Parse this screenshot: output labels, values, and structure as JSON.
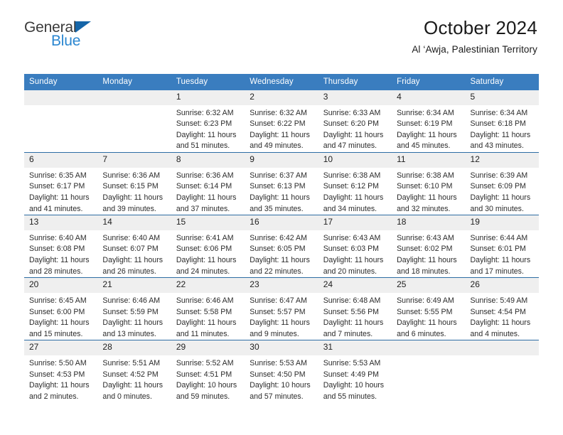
{
  "brand": {
    "line1": "General",
    "line2": "Blue",
    "flag_color": "#1565a8",
    "blue_text_color": "#2a86d0"
  },
  "header": {
    "title": "October 2024",
    "subtitle": "Al ‘Awja, Palestinian Territory"
  },
  "theme": {
    "header_bg": "#3a7dbf",
    "row_divider": "#2e6da4",
    "daynum_bg": "#efefef"
  },
  "calendar": {
    "weekday_headers": [
      "Sunday",
      "Monday",
      "Tuesday",
      "Wednesday",
      "Thursday",
      "Friday",
      "Saturday"
    ],
    "labels": {
      "sunrise": "Sunrise:",
      "sunset": "Sunset:",
      "daylight": "Daylight:"
    },
    "weeks": [
      [
        {
          "day": "",
          "empty": true
        },
        {
          "day": "",
          "empty": true
        },
        {
          "day": "1",
          "sunrise": "Sunrise: 6:32 AM",
          "sunset": "Sunset: 6:23 PM",
          "daylight": "Daylight: 11 hours and 51 minutes."
        },
        {
          "day": "2",
          "sunrise": "Sunrise: 6:32 AM",
          "sunset": "Sunset: 6:22 PM",
          "daylight": "Daylight: 11 hours and 49 minutes."
        },
        {
          "day": "3",
          "sunrise": "Sunrise: 6:33 AM",
          "sunset": "Sunset: 6:20 PM",
          "daylight": "Daylight: 11 hours and 47 minutes."
        },
        {
          "day": "4",
          "sunrise": "Sunrise: 6:34 AM",
          "sunset": "Sunset: 6:19 PM",
          "daylight": "Daylight: 11 hours and 45 minutes."
        },
        {
          "day": "5",
          "sunrise": "Sunrise: 6:34 AM",
          "sunset": "Sunset: 6:18 PM",
          "daylight": "Daylight: 11 hours and 43 minutes."
        }
      ],
      [
        {
          "day": "6",
          "sunrise": "Sunrise: 6:35 AM",
          "sunset": "Sunset: 6:17 PM",
          "daylight": "Daylight: 11 hours and 41 minutes."
        },
        {
          "day": "7",
          "sunrise": "Sunrise: 6:36 AM",
          "sunset": "Sunset: 6:15 PM",
          "daylight": "Daylight: 11 hours and 39 minutes."
        },
        {
          "day": "8",
          "sunrise": "Sunrise: 6:36 AM",
          "sunset": "Sunset: 6:14 PM",
          "daylight": "Daylight: 11 hours and 37 minutes."
        },
        {
          "day": "9",
          "sunrise": "Sunrise: 6:37 AM",
          "sunset": "Sunset: 6:13 PM",
          "daylight": "Daylight: 11 hours and 35 minutes."
        },
        {
          "day": "10",
          "sunrise": "Sunrise: 6:38 AM",
          "sunset": "Sunset: 6:12 PM",
          "daylight": "Daylight: 11 hours and 34 minutes."
        },
        {
          "day": "11",
          "sunrise": "Sunrise: 6:38 AM",
          "sunset": "Sunset: 6:10 PM",
          "daylight": "Daylight: 11 hours and 32 minutes."
        },
        {
          "day": "12",
          "sunrise": "Sunrise: 6:39 AM",
          "sunset": "Sunset: 6:09 PM",
          "daylight": "Daylight: 11 hours and 30 minutes."
        }
      ],
      [
        {
          "day": "13",
          "sunrise": "Sunrise: 6:40 AM",
          "sunset": "Sunset: 6:08 PM",
          "daylight": "Daylight: 11 hours and 28 minutes."
        },
        {
          "day": "14",
          "sunrise": "Sunrise: 6:40 AM",
          "sunset": "Sunset: 6:07 PM",
          "daylight": "Daylight: 11 hours and 26 minutes."
        },
        {
          "day": "15",
          "sunrise": "Sunrise: 6:41 AM",
          "sunset": "Sunset: 6:06 PM",
          "daylight": "Daylight: 11 hours and 24 minutes."
        },
        {
          "day": "16",
          "sunrise": "Sunrise: 6:42 AM",
          "sunset": "Sunset: 6:05 PM",
          "daylight": "Daylight: 11 hours and 22 minutes."
        },
        {
          "day": "17",
          "sunrise": "Sunrise: 6:43 AM",
          "sunset": "Sunset: 6:03 PM",
          "daylight": "Daylight: 11 hours and 20 minutes."
        },
        {
          "day": "18",
          "sunrise": "Sunrise: 6:43 AM",
          "sunset": "Sunset: 6:02 PM",
          "daylight": "Daylight: 11 hours and 18 minutes."
        },
        {
          "day": "19",
          "sunrise": "Sunrise: 6:44 AM",
          "sunset": "Sunset: 6:01 PM",
          "daylight": "Daylight: 11 hours and 17 minutes."
        }
      ],
      [
        {
          "day": "20",
          "sunrise": "Sunrise: 6:45 AM",
          "sunset": "Sunset: 6:00 PM",
          "daylight": "Daylight: 11 hours and 15 minutes."
        },
        {
          "day": "21",
          "sunrise": "Sunrise: 6:46 AM",
          "sunset": "Sunset: 5:59 PM",
          "daylight": "Daylight: 11 hours and 13 minutes."
        },
        {
          "day": "22",
          "sunrise": "Sunrise: 6:46 AM",
          "sunset": "Sunset: 5:58 PM",
          "daylight": "Daylight: 11 hours and 11 minutes."
        },
        {
          "day": "23",
          "sunrise": "Sunrise: 6:47 AM",
          "sunset": "Sunset: 5:57 PM",
          "daylight": "Daylight: 11 hours and 9 minutes."
        },
        {
          "day": "24",
          "sunrise": "Sunrise: 6:48 AM",
          "sunset": "Sunset: 5:56 PM",
          "daylight": "Daylight: 11 hours and 7 minutes."
        },
        {
          "day": "25",
          "sunrise": "Sunrise: 6:49 AM",
          "sunset": "Sunset: 5:55 PM",
          "daylight": "Daylight: 11 hours and 6 minutes."
        },
        {
          "day": "26",
          "sunrise": "Sunrise: 5:49 AM",
          "sunset": "Sunset: 4:54 PM",
          "daylight": "Daylight: 11 hours and 4 minutes."
        }
      ],
      [
        {
          "day": "27",
          "sunrise": "Sunrise: 5:50 AM",
          "sunset": "Sunset: 4:53 PM",
          "daylight": "Daylight: 11 hours and 2 minutes."
        },
        {
          "day": "28",
          "sunrise": "Sunrise: 5:51 AM",
          "sunset": "Sunset: 4:52 PM",
          "daylight": "Daylight: 11 hours and 0 minutes."
        },
        {
          "day": "29",
          "sunrise": "Sunrise: 5:52 AM",
          "sunset": "Sunset: 4:51 PM",
          "daylight": "Daylight: 10 hours and 59 minutes."
        },
        {
          "day": "30",
          "sunrise": "Sunrise: 5:53 AM",
          "sunset": "Sunset: 4:50 PM",
          "daylight": "Daylight: 10 hours and 57 minutes."
        },
        {
          "day": "31",
          "sunrise": "Sunrise: 5:53 AM",
          "sunset": "Sunset: 4:49 PM",
          "daylight": "Daylight: 10 hours and 55 minutes."
        },
        {
          "day": "",
          "empty": true
        },
        {
          "day": "",
          "empty": true
        }
      ]
    ]
  }
}
